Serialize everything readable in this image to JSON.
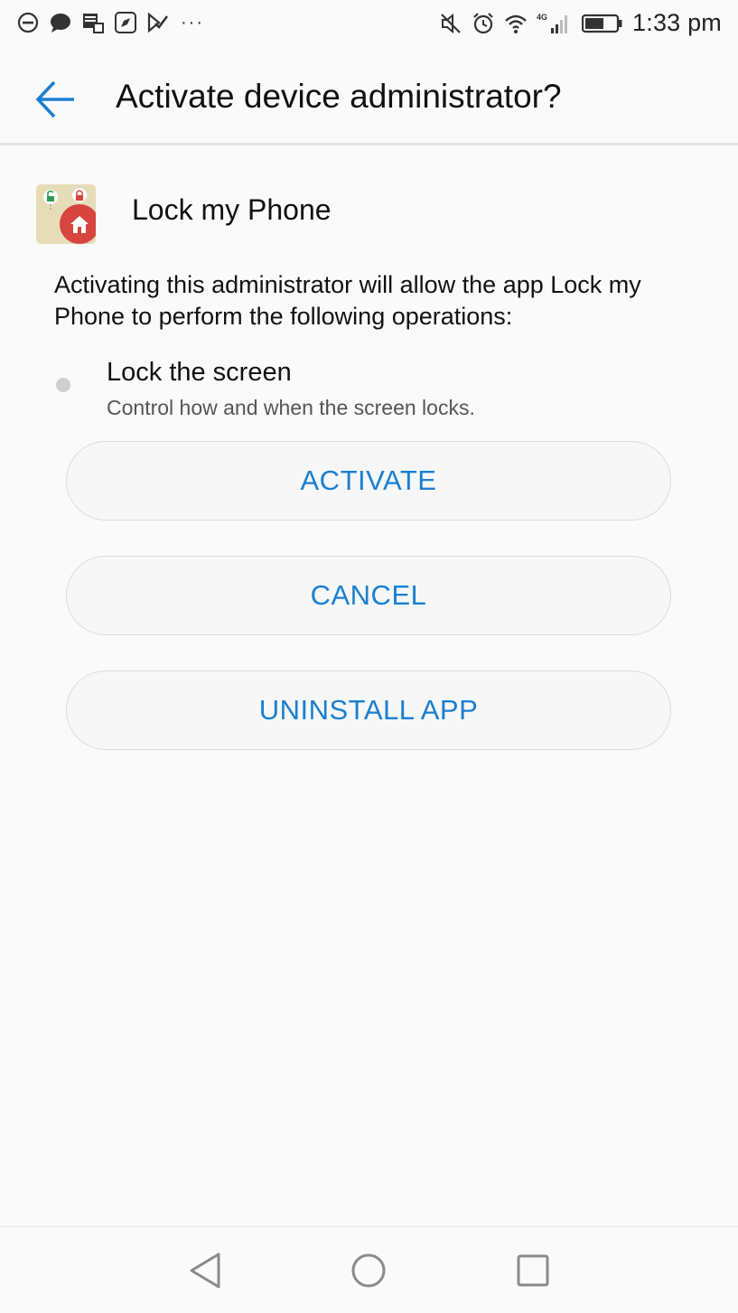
{
  "status_bar": {
    "left_icons": [
      "do-not-disturb-icon",
      "chat-icon",
      "tasks-icon",
      "compass-icon",
      "checkmark-icon"
    ],
    "overflow": "···",
    "right_icons": [
      "mute-icon",
      "alarm-icon",
      "wifi-icon",
      "signal-4g-icon",
      "battery-icon"
    ],
    "network": "4G",
    "time": "1:33 pm"
  },
  "header": {
    "title": "Activate device administrator?",
    "back_icon": "arrow-left-icon",
    "accent_color": "#1a7fd1"
  },
  "app": {
    "name": "Lock my Phone",
    "icon": "lock-my-phone-app-icon"
  },
  "description": "Activating this administrator will allow the app Lock my Phone to perform the following operations:",
  "permissions": [
    {
      "title": "Lock the screen",
      "description": "Control how and when the screen locks."
    }
  ],
  "buttons": {
    "activate": "ACTIVATE",
    "cancel": "CANCEL",
    "uninstall": "UNINSTALL APP"
  },
  "nav_bar": {
    "back": "triangle-back-icon",
    "home": "circle-home-icon",
    "recents": "square-recents-icon"
  }
}
